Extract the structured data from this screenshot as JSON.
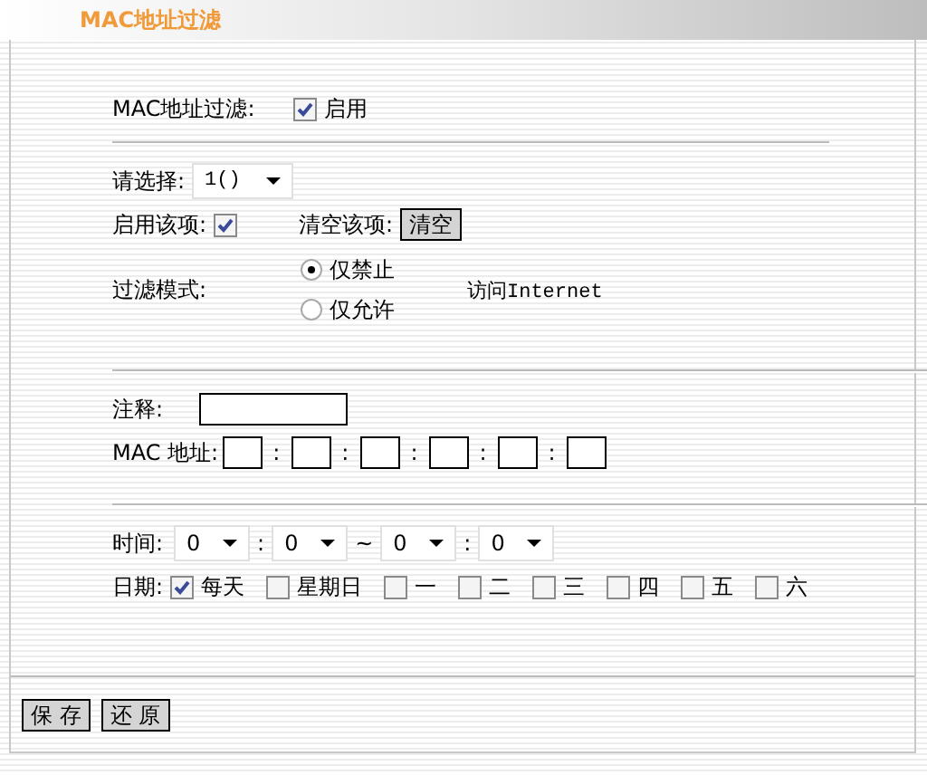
{
  "title": "MAC地址过滤",
  "filter_enable": {
    "label": "MAC地址过滤:",
    "checkbox_label": "启用",
    "checked": true
  },
  "select": {
    "label": "请选择:",
    "value": "1()"
  },
  "item_enable": {
    "label": "启用该项:",
    "checked": true
  },
  "clear": {
    "label": "清空该项:",
    "button": "清空"
  },
  "mode": {
    "label": "过滤模式:",
    "options": [
      {
        "label": "仅禁止",
        "selected": true
      },
      {
        "label": "仅允许",
        "selected": false
      }
    ],
    "target": "访问Internet"
  },
  "note": {
    "label": "注释:"
  },
  "mac": {
    "label": "MAC 地址:",
    "separators": [
      ":",
      ":",
      ":",
      ":",
      ":"
    ]
  },
  "time": {
    "label": "时间:",
    "fields": [
      {
        "value": "0"
      },
      {
        "value": "0"
      },
      {
        "value": "0"
      },
      {
        "value": "0"
      }
    ],
    "separators": [
      ":",
      "~",
      ":"
    ]
  },
  "date": {
    "label": "日期:",
    "days": [
      {
        "label": "每天",
        "checked": true
      },
      {
        "label": "星期日",
        "checked": false
      },
      {
        "label": "一",
        "checked": false
      },
      {
        "label": "二",
        "checked": false
      },
      {
        "label": "三",
        "checked": false
      },
      {
        "label": "四",
        "checked": false
      },
      {
        "label": "五",
        "checked": false
      },
      {
        "label": "六",
        "checked": false
      }
    ]
  },
  "buttons": [
    "保 存",
    "还 原"
  ]
}
